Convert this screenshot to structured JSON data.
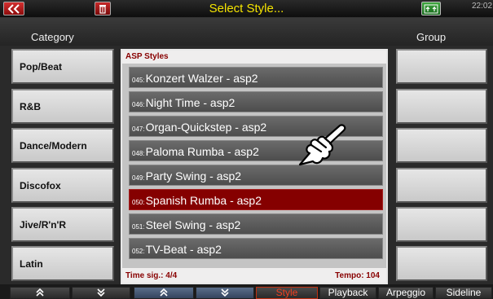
{
  "title": "Select Style...",
  "clock": "22:02",
  "titlebar": {
    "back_icon": "double-chevron-left-icon",
    "trash_icon": "trash-icon",
    "memory_icon": "memory-icon"
  },
  "headers": {
    "category": "Category",
    "group": "Group"
  },
  "categories": [
    "Pop/Beat",
    "R&B",
    "Dance/Modern",
    "Discofox",
    "Jive/R'n'R",
    "Latin"
  ],
  "groups_count": 6,
  "panel": {
    "title": "ASP Styles",
    "time_sig": "Time sig.: 4/4",
    "tempo": "Tempo: 104"
  },
  "styles": [
    {
      "num": "045:",
      "name": "Konzert Walzer - asp2",
      "selected": false
    },
    {
      "num": "046:",
      "name": "Night Time - asp2",
      "selected": false
    },
    {
      "num": "047:",
      "name": "Organ-Quickstep - asp2",
      "selected": false
    },
    {
      "num": "048:",
      "name": "Paloma Rumba - asp2",
      "selected": false
    },
    {
      "num": "049:",
      "name": "Party Swing - asp2",
      "selected": false
    },
    {
      "num": "050:",
      "name": "Spanish Rumba - asp2",
      "selected": true
    },
    {
      "num": "051:",
      "name": "Steel Swing - asp2",
      "selected": false
    },
    {
      "num": "052:",
      "name": "TV-Beat - asp2",
      "selected": false
    }
  ],
  "bottom": {
    "style": "Style",
    "playback": "Playback",
    "arpeggio": "Arpeggio",
    "sideline": "Sideline"
  },
  "colors": {
    "title": "#f5e400",
    "selected_row": "#850000",
    "panel_text": "#880000",
    "active_tab": "#f04020"
  }
}
